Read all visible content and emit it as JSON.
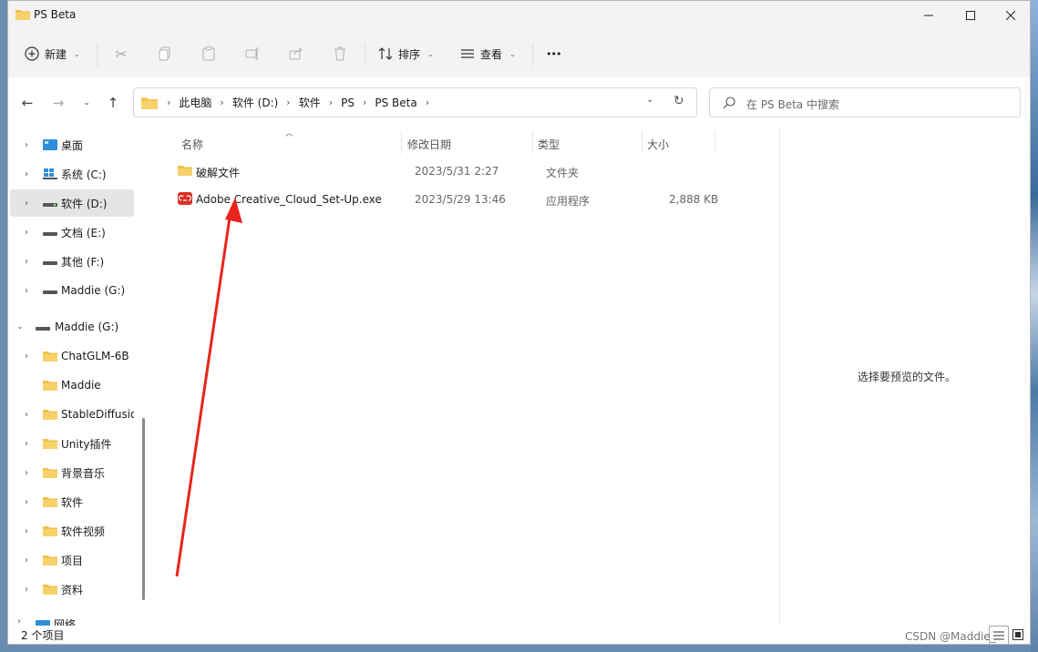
{
  "window": {
    "title": "PS Beta"
  },
  "toolbar": {
    "new_label": "新建",
    "sort_label": "排序",
    "view_label": "查看",
    "more_label": "•••"
  },
  "breadcrumb": {
    "items": [
      "此电脑",
      "软件 (D:)",
      "软件",
      "PS",
      "PS Beta"
    ]
  },
  "search": {
    "placeholder": "在 PS Beta 中搜索"
  },
  "sidebar": {
    "items": [
      {
        "label": "桌面"
      },
      {
        "label": "系统 (C:)"
      },
      {
        "label": "软件 (D:)"
      },
      {
        "label": "文档 (E:)"
      },
      {
        "label": "其他 (F:)"
      },
      {
        "label": "Maddie (G:)"
      },
      {
        "label": "Maddie (G:)"
      },
      {
        "label": "ChatGLM-6B"
      },
      {
        "label": "Maddie"
      },
      {
        "label": "StableDiffusio"
      },
      {
        "label": "Unity插件"
      },
      {
        "label": "背景音乐"
      },
      {
        "label": "软件"
      },
      {
        "label": "软件视频"
      },
      {
        "label": "项目"
      },
      {
        "label": "资料"
      },
      {
        "label": "网络"
      }
    ]
  },
  "columns": {
    "name": "名称",
    "modified": "修改日期",
    "type": "类型",
    "size": "大小"
  },
  "files": [
    {
      "name": "破解文件",
      "modified": "2023/5/31 2:27",
      "type": "文件夹",
      "size": ""
    },
    {
      "name": "Adobe Creative_Cloud_Set-Up.exe",
      "modified": "2023/5/29 13:46",
      "type": "应用程序",
      "size": "2,888 KB"
    }
  ],
  "preview_text": "选择要预览的文件。",
  "status": {
    "item_count": "2 个项目"
  },
  "watermark": "CSDN @Maddie_",
  "colors": {
    "folder": "#f0c24b",
    "accent": "#d93025",
    "arrow": "#e8251d"
  }
}
